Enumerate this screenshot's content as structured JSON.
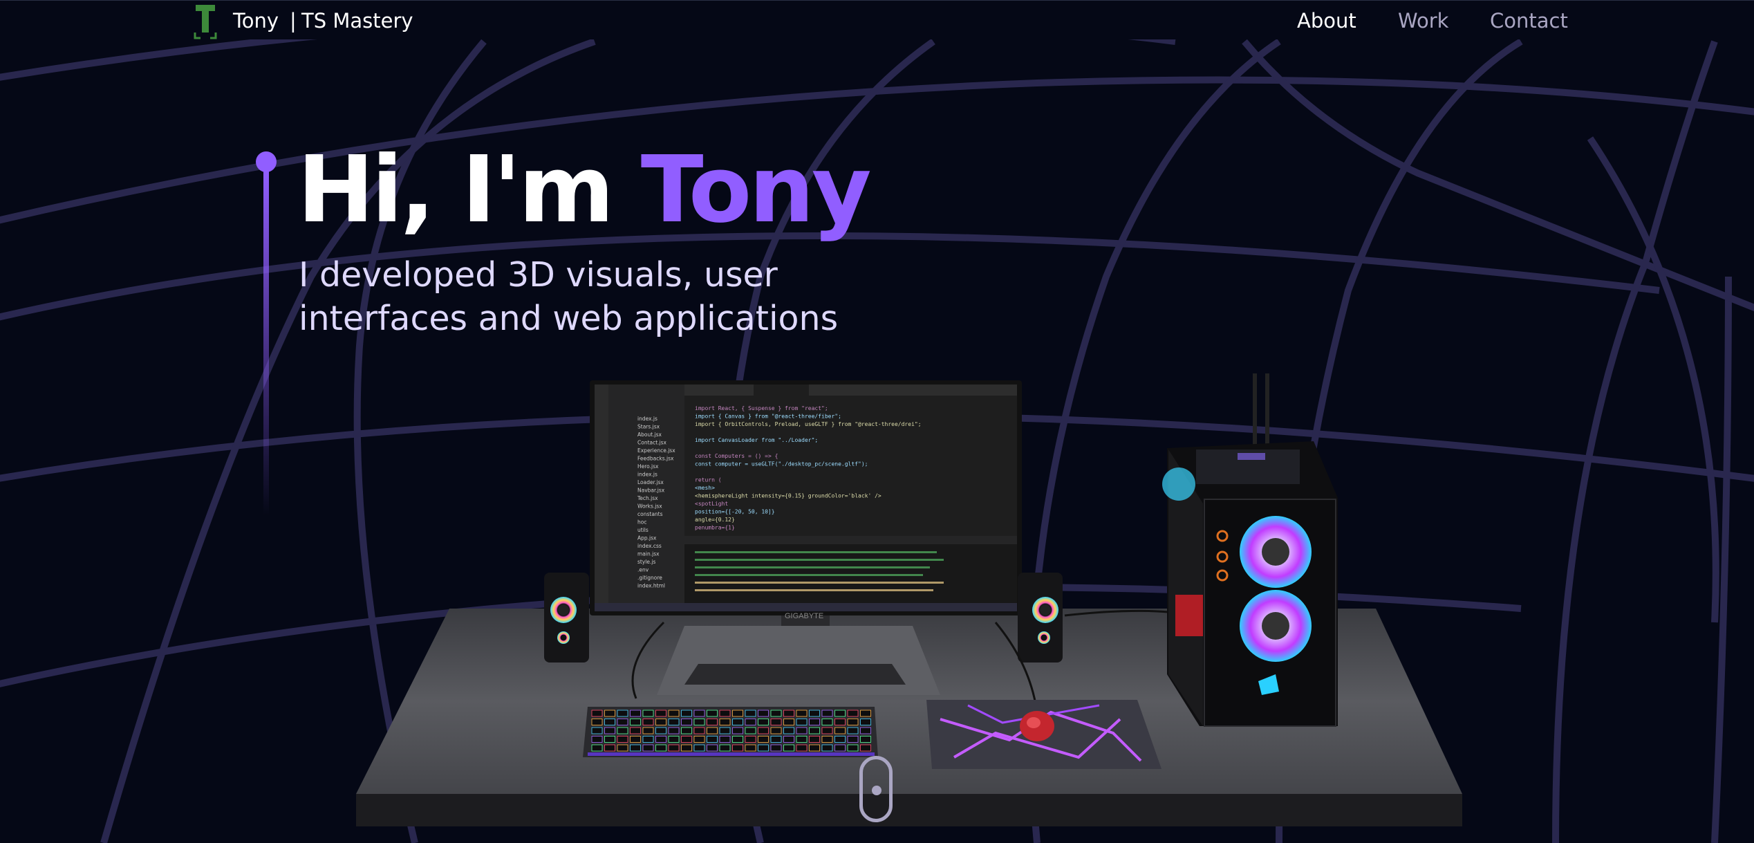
{
  "nav": {
    "brand_name": "Tony",
    "brand_separator": "|",
    "brand_tagline": "TS Mastery",
    "links": [
      {
        "label": "About",
        "active": true
      },
      {
        "label": "Work",
        "active": false
      },
      {
        "label": "Contact",
        "active": false
      }
    ]
  },
  "hero": {
    "greeting": "Hi, I'm ",
    "name": "Tony",
    "subtitle_line1": "I developed 3D visuals, user",
    "subtitle_line2": "interfaces and web applications"
  },
  "monitor": {
    "brand": "GIGABYTE",
    "code_lines": [
      "import React, { Suspense } from \"react\";",
      "import { Canvas } from \"@react-three/fiber\";",
      "import { OrbitControls, Preload, useGLTF } from \"@react-three/drei\";",
      "",
      "import CanvasLoader from \"../Loader\";",
      "",
      "const Computers = () => {",
      "  const computer = useGLTF(\"./desktop_pc/scene.gltf\");",
      "",
      "  return (",
      "    <mesh>",
      "      <hemisphereLight intensity={0.15} groundColor='black' />",
      "      <spotLight",
      "        position={[-20, 50, 10]}",
      "        angle={0.12}",
      "        penumbra={1}"
    ],
    "files": [
      "index.js",
      "Stars.jsx",
      "About.jsx",
      "Contact.jsx",
      "Experience.jsx",
      "Feedbacks.jsx",
      "Hero.jsx",
      "index.js",
      "Loader.jsx",
      "Navbar.jsx",
      "Tech.jsx",
      "Works.jsx",
      "constants",
      "hoc",
      "utils",
      "App.jsx",
      "index.css",
      "main.jsx",
      "style.js",
      ".env",
      ".gitignore",
      "index.html"
    ]
  },
  "colors": {
    "background": "#050816",
    "accent": "#915eff",
    "nav_inactive": "#aaa6c3",
    "logo_green": "#3d8a3a"
  },
  "icons": {
    "logo": "t-logo-icon",
    "scroll": "mouse-scroll-icon"
  }
}
